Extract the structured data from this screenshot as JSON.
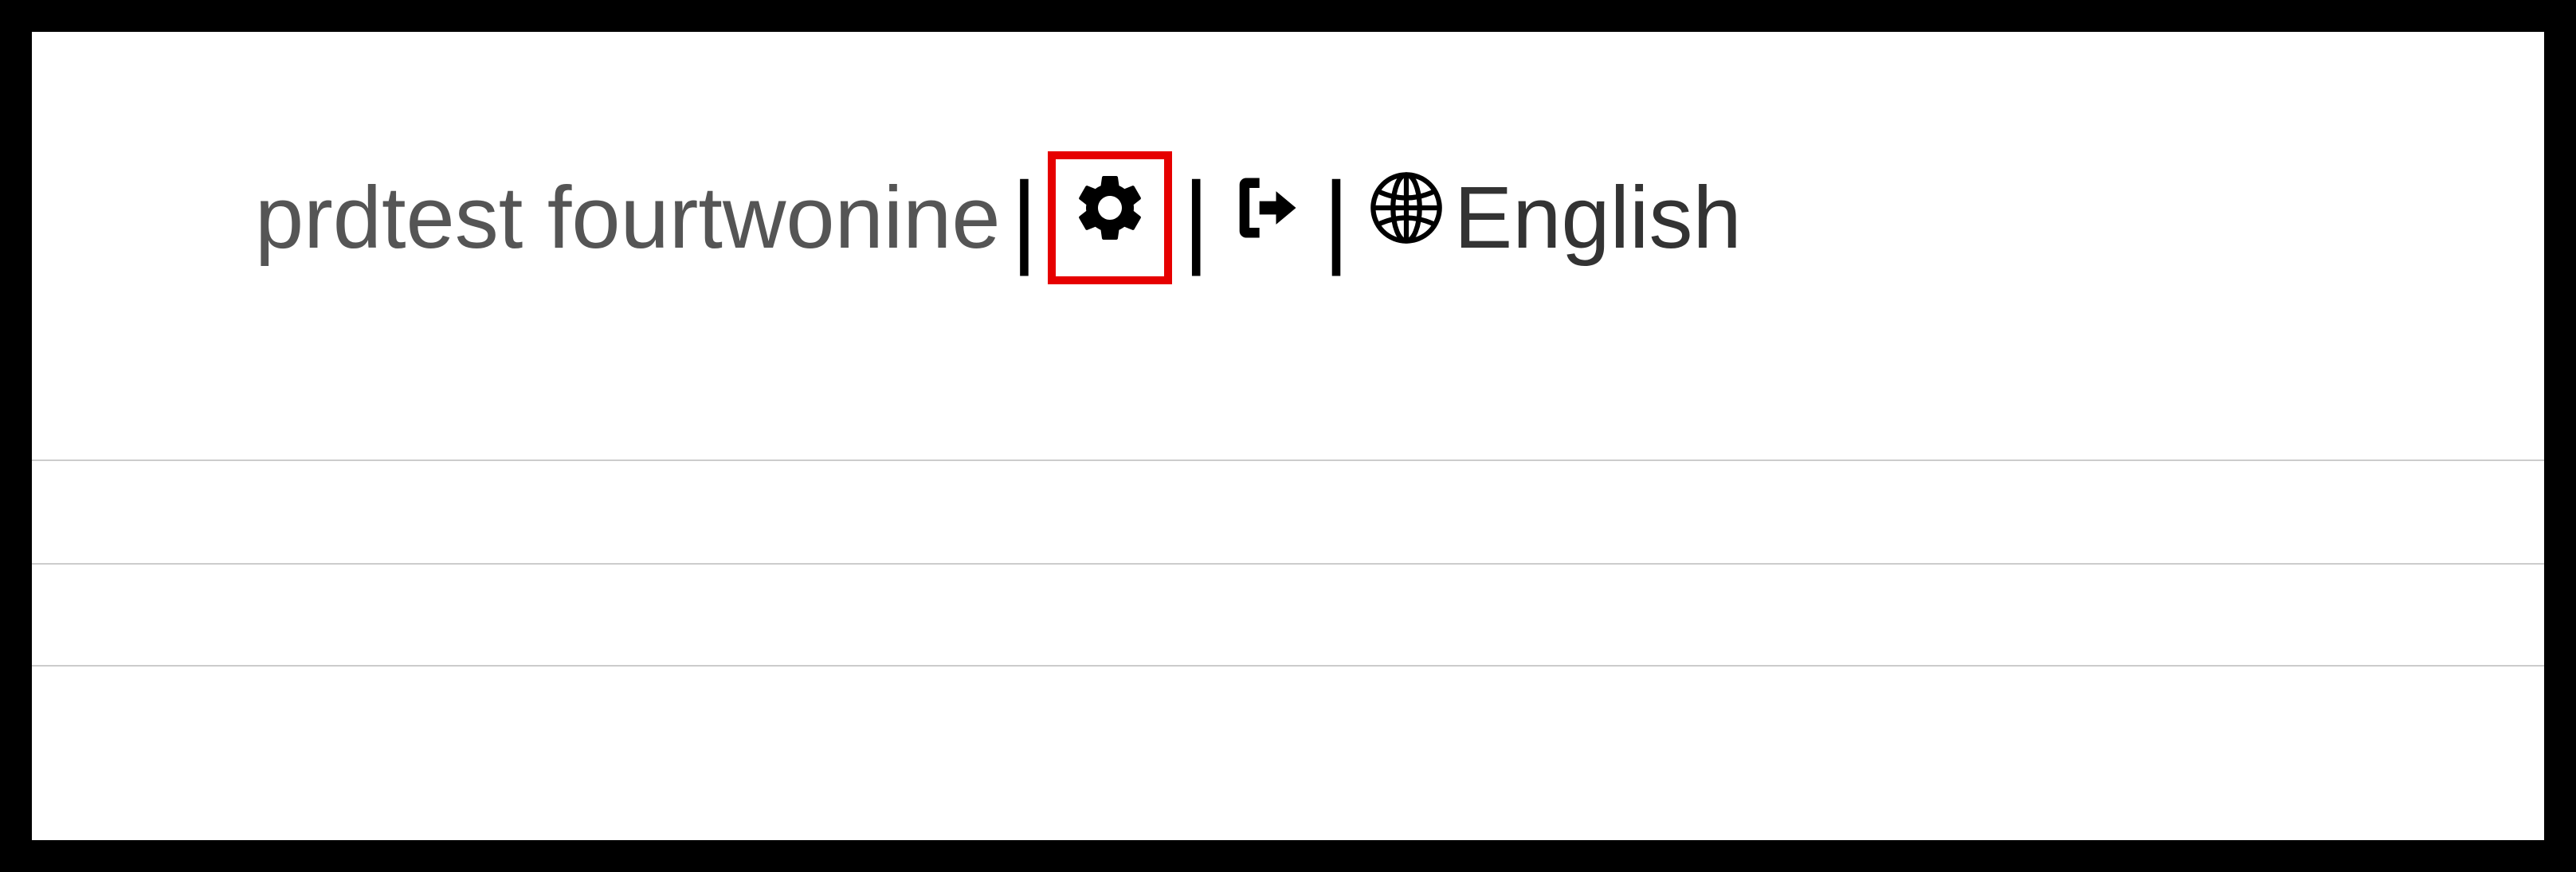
{
  "header": {
    "username": "prdtest fourtwonine",
    "language": "English",
    "icons": {
      "settings": "gear-icon",
      "logout": "logout-icon",
      "language": "globe-icon"
    },
    "highlight_color": "#e60000"
  }
}
